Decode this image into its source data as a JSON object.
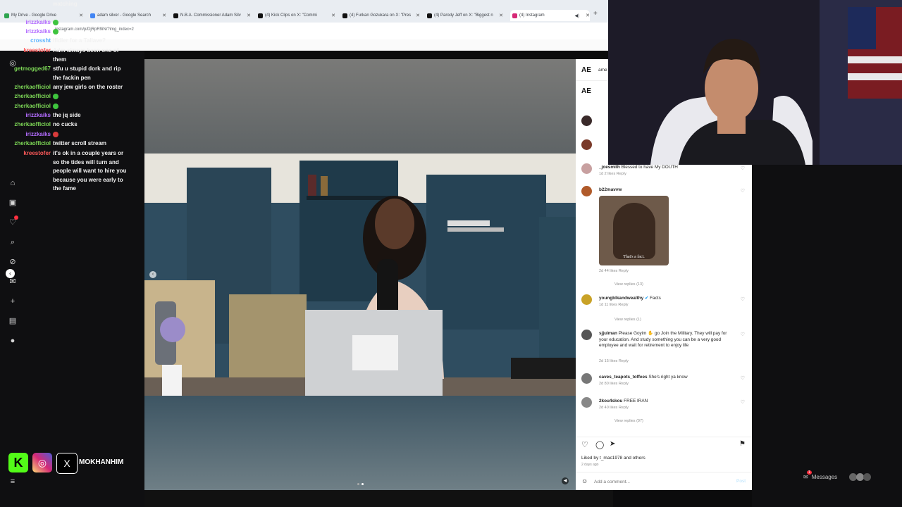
{
  "browser": {
    "tabs": [
      {
        "label": "My Drive - Google Drive",
        "color": "#2ea44f"
      },
      {
        "label": "adam silver - Google Search",
        "color": "#4285f4"
      },
      {
        "label": "N.B.A. Commissioner Adam Silv",
        "color": "#111111"
      },
      {
        "label": "(4) Kick Clips on X: \"Commi",
        "color": "#111111"
      },
      {
        "label": "(4) Furkan Gozukara on X: \"Pres",
        "color": "#111111"
      },
      {
        "label": "(4) Parody Jeff on X: \"Biggest n",
        "color": "#111111"
      },
      {
        "label": "(4) Instagram",
        "color": "#d62976"
      }
    ],
    "url": "instagram.com/p/DjRpR9iN/?img_index=2"
  },
  "chat": [
    {
      "user": "",
      "msg": "watching",
      "color": "#ffffff"
    },
    {
      "user": "irizzkaiks",
      "msg": "",
      "color": "#b36cff",
      "emote": "#3ec43e"
    },
    {
      "user": "irizzkaiks",
      "msg": "",
      "color": "#b36cff",
      "emote": "#3ec43e"
    },
    {
      "user": "crossht",
      "msg": "Ifidler for a Tallave?",
      "color": "#5fb6ff"
    },
    {
      "user": "kreestofer",
      "msg": "Adm always been one of",
      "color": "#ff5a5a"
    },
    {
      "user": "",
      "msg": "them",
      "color": "#ffffff"
    },
    {
      "user": "getmogged67",
      "msg": "stfu u stupid dork and rip the fackin pen",
      "color": "#7ed957"
    },
    {
      "user": "zherkaofficiol",
      "msg": "any jew girls on the roster",
      "color": "#7ed957"
    },
    {
      "user": "zherkaofficiol",
      "msg": "",
      "color": "#7ed957",
      "emote": "#3ec43e"
    },
    {
      "user": "zherkaofficiol",
      "msg": "",
      "color": "#7ed957",
      "emote": "#3ec43e"
    },
    {
      "user": "irizzkaiks",
      "msg": "the jq side",
      "color": "#b36cff"
    },
    {
      "user": "zherkaofficiol",
      "msg": "no cucks",
      "color": "#7ed957"
    },
    {
      "user": "irizzkaiks",
      "msg": "",
      "color": "#b36cff",
      "emote": "#d83b3b"
    },
    {
      "user": "zherkaofficiol",
      "msg": "twitter scroll stream",
      "color": "#7ed957"
    },
    {
      "user": "kreestofer",
      "msg": "it's ok in a couple years or so the tides will turn and people will want to hire you because you were early to the fame",
      "color": "#ff5a5a"
    }
  ],
  "post": {
    "header_user": "ame",
    "comments": [
      {
        "user": "_joesmith",
        "text": "Blessed to have My DOUTH",
        "meta": "1d  2 likes  Reply",
        "color": "#c8a0a0"
      },
      {
        "user": "b22mavvw",
        "text": "",
        "meta": "2d  44 likes  Reply",
        "color": "#b05a2a",
        "gif_caption": "That's a fact.",
        "view": "View replies (13)"
      },
      {
        "user": "youngblkandwealthy",
        "text": "Facts",
        "meta": "1d  11 likes  Reply",
        "color": "#c9a227",
        "view": "View replies (1)"
      },
      {
        "user": "sjjuiman",
        "text": "Please Goyim ✋ go Join the Military. They will pay for your education. And study something you can be a very good employee and wait for retirement to enjoy life",
        "meta": "2d  15 likes  Reply",
        "color": "#555555"
      },
      {
        "user": "caves_teapots_toffees",
        "text": "She's right ya know",
        "meta": "2d  80 likes  Reply",
        "color": "#777777"
      },
      {
        "user": "2kou4skou",
        "text": "FREE IRAN",
        "meta": "2d  40 likes  Reply",
        "color": "#888888",
        "view": "View replies (97)"
      }
    ],
    "liked_by": "Liked by t_mac1978 and others",
    "time_ago": "2 days ago",
    "add_comment_placeholder": "Add a comment...",
    "post_button": "Post"
  },
  "streamer": {
    "handle": "MOKHANHIM"
  },
  "messages_label": "Messages",
  "messages_badge": "1"
}
